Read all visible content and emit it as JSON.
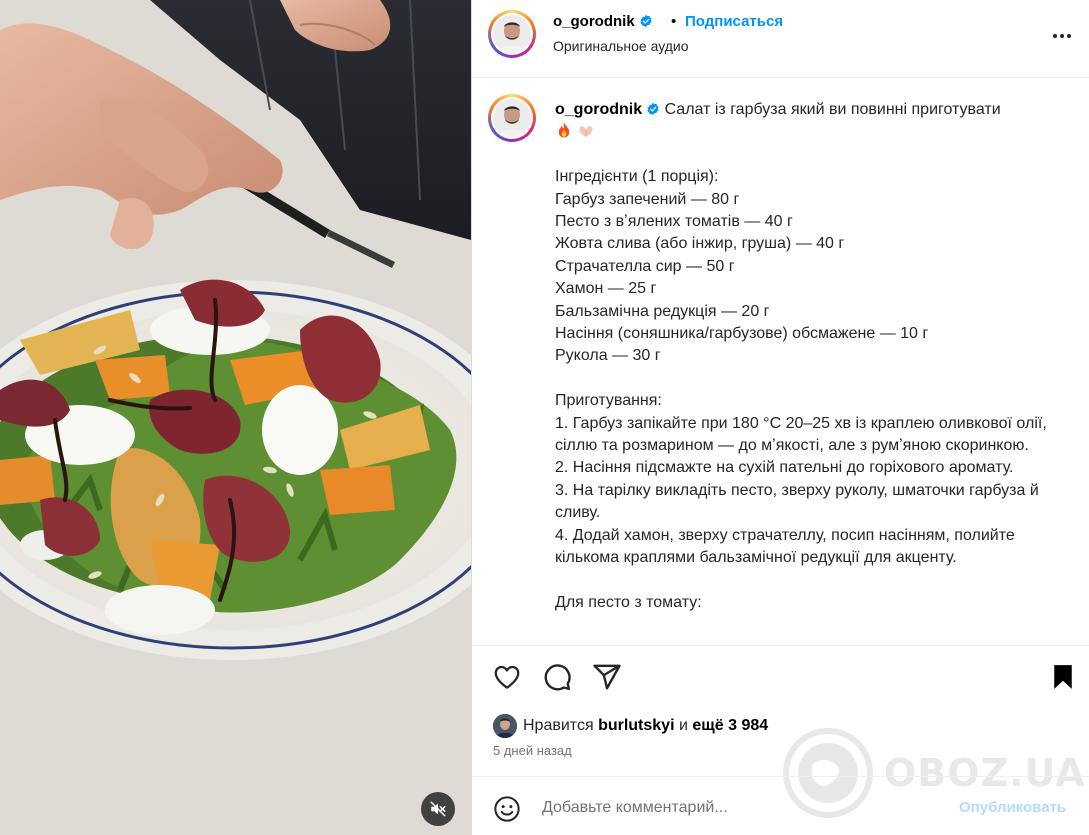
{
  "header": {
    "username": "o_gorodnik",
    "separator": "•",
    "follow_label": "Подписаться",
    "audio": "Оригинальное аудио"
  },
  "caption": {
    "username": "o_gorodnik",
    "title": "Салат із гарбуза який ви повинні приготувати",
    "ingredients_heading": "Інгредієнти (1 порція):",
    "ingredients": [
      "Гарбуз запечений — 80 г",
      "Песто з вʼялених томатів — 40 г",
      "Жовта слива (або інжир, груша) — 40 г",
      "Страчателла сир — 50 г",
      "Хамон — 25 г",
      "Бальзамічна редукція — 20 г",
      "Насіння (соняшника/гарбузове) обсмажене — 10 г",
      "Рукола — 30 г"
    ],
    "steps_heading": "Приготування:",
    "steps": [
      "1. Гарбуз запікайте при 180 °C 20–25 хв із краплею оливкової олії, сіллю та розмарином — до мʼякості, але з румʼяною скоринкою.",
      "2. Насіння підсмажте на сухій пательні до горіхового аромату.",
      "3. На тарілку викладіть песто, зверху руколу, шматочки гарбуза й сливу.",
      "4. Додай хамон, зверху страчателлу, посип насінням, полийте кількома краплями бальзамічної редукції для акценту."
    ],
    "pesto_heading": "Для песто з томату:"
  },
  "likes": {
    "prefix": "Нравится",
    "user": "burlutskyi",
    "and": "и",
    "more": "ещё 3 984"
  },
  "date": "5 дней назад",
  "comment": {
    "placeholder": "Добавьте комментарий...",
    "publish_label": "Опубликовать"
  },
  "watermark": "OBOZ.UA",
  "colors": {
    "accent": "#0095f6",
    "publish_disabled": "#b3dbff",
    "verified": "#0095f6"
  }
}
